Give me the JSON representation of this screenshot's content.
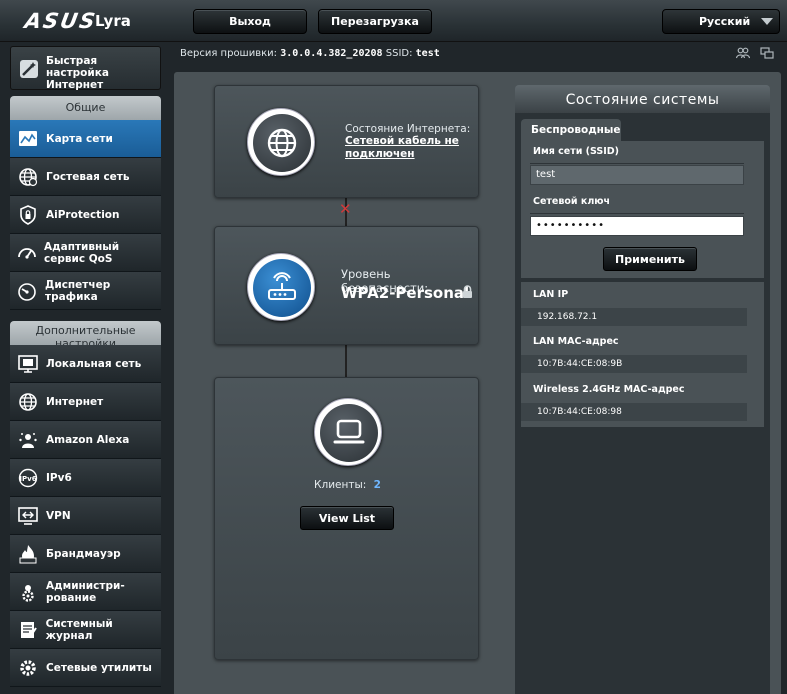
{
  "header": {
    "brand": "ASUS",
    "model": "Lyra",
    "logout_label": "Выход",
    "reboot_label": "Перезагрузка",
    "language": "Русский"
  },
  "firmware": {
    "label": "Версия прошивки:",
    "version": "3.0.0.4.382_20208",
    "ssid_label": "SSID:",
    "ssid": "test"
  },
  "sidebar": {
    "quick_setup": "Быстрая настройка Интернет",
    "general_header": "Общие",
    "general_items": [
      {
        "label": "Карта сети",
        "icon": "network-map-icon"
      },
      {
        "label": "Гостевая сеть",
        "icon": "guest-network-icon"
      },
      {
        "label": "AiProtection",
        "icon": "shield-icon"
      },
      {
        "label": "Адаптивный сервис QoS",
        "icon": "qos-gauge-icon"
      },
      {
        "label": "Диспетчер трафика",
        "icon": "traffic-gauge-icon"
      }
    ],
    "advanced_header": "Дополнительные настройки",
    "advanced_items": [
      {
        "label": "Локальная сеть",
        "icon": "lan-icon"
      },
      {
        "label": "Интернет",
        "icon": "globe-icon"
      },
      {
        "label": "Amazon Alexa",
        "icon": "alexa-icon"
      },
      {
        "label": "IPv6",
        "icon": "ipv6-icon"
      },
      {
        "label": "VPN",
        "icon": "vpn-icon"
      },
      {
        "label": "Брандмауэр",
        "icon": "firewall-icon"
      },
      {
        "label": "Администри-рование",
        "icon": "admin-gear-icon"
      },
      {
        "label": "Системный журнал",
        "icon": "system-log-icon"
      },
      {
        "label": "Сетевые утилиты",
        "icon": "network-tools-icon"
      }
    ]
  },
  "map": {
    "internet_status_label": "Состояние Интернета:",
    "internet_status_value": "Сетевой кабель не подключен",
    "security_label": "Уровень безопасности:",
    "security_value": "WPA2-Personal",
    "clients_label": "Клиенты:",
    "clients_count": "2",
    "view_list_label": "View List"
  },
  "status": {
    "title": "Состояние системы",
    "tab_wireless": "Беспроводные",
    "ssid_label": "Имя сети (SSID)",
    "ssid_value": "test",
    "key_label": "Сетевой ключ",
    "key_value": "••••••••••",
    "apply_label": "Применить",
    "lan_ip_label": "LAN IP",
    "lan_ip_value": "192.168.72.1",
    "lan_mac_label": "LAN MAC-адрес",
    "lan_mac_value": "10:7B:44:CE:08:9B",
    "wl_mac_label": "Wireless 2.4GHz MAC-адрес",
    "wl_mac_value": "10:7B:44:CE:08:98"
  }
}
